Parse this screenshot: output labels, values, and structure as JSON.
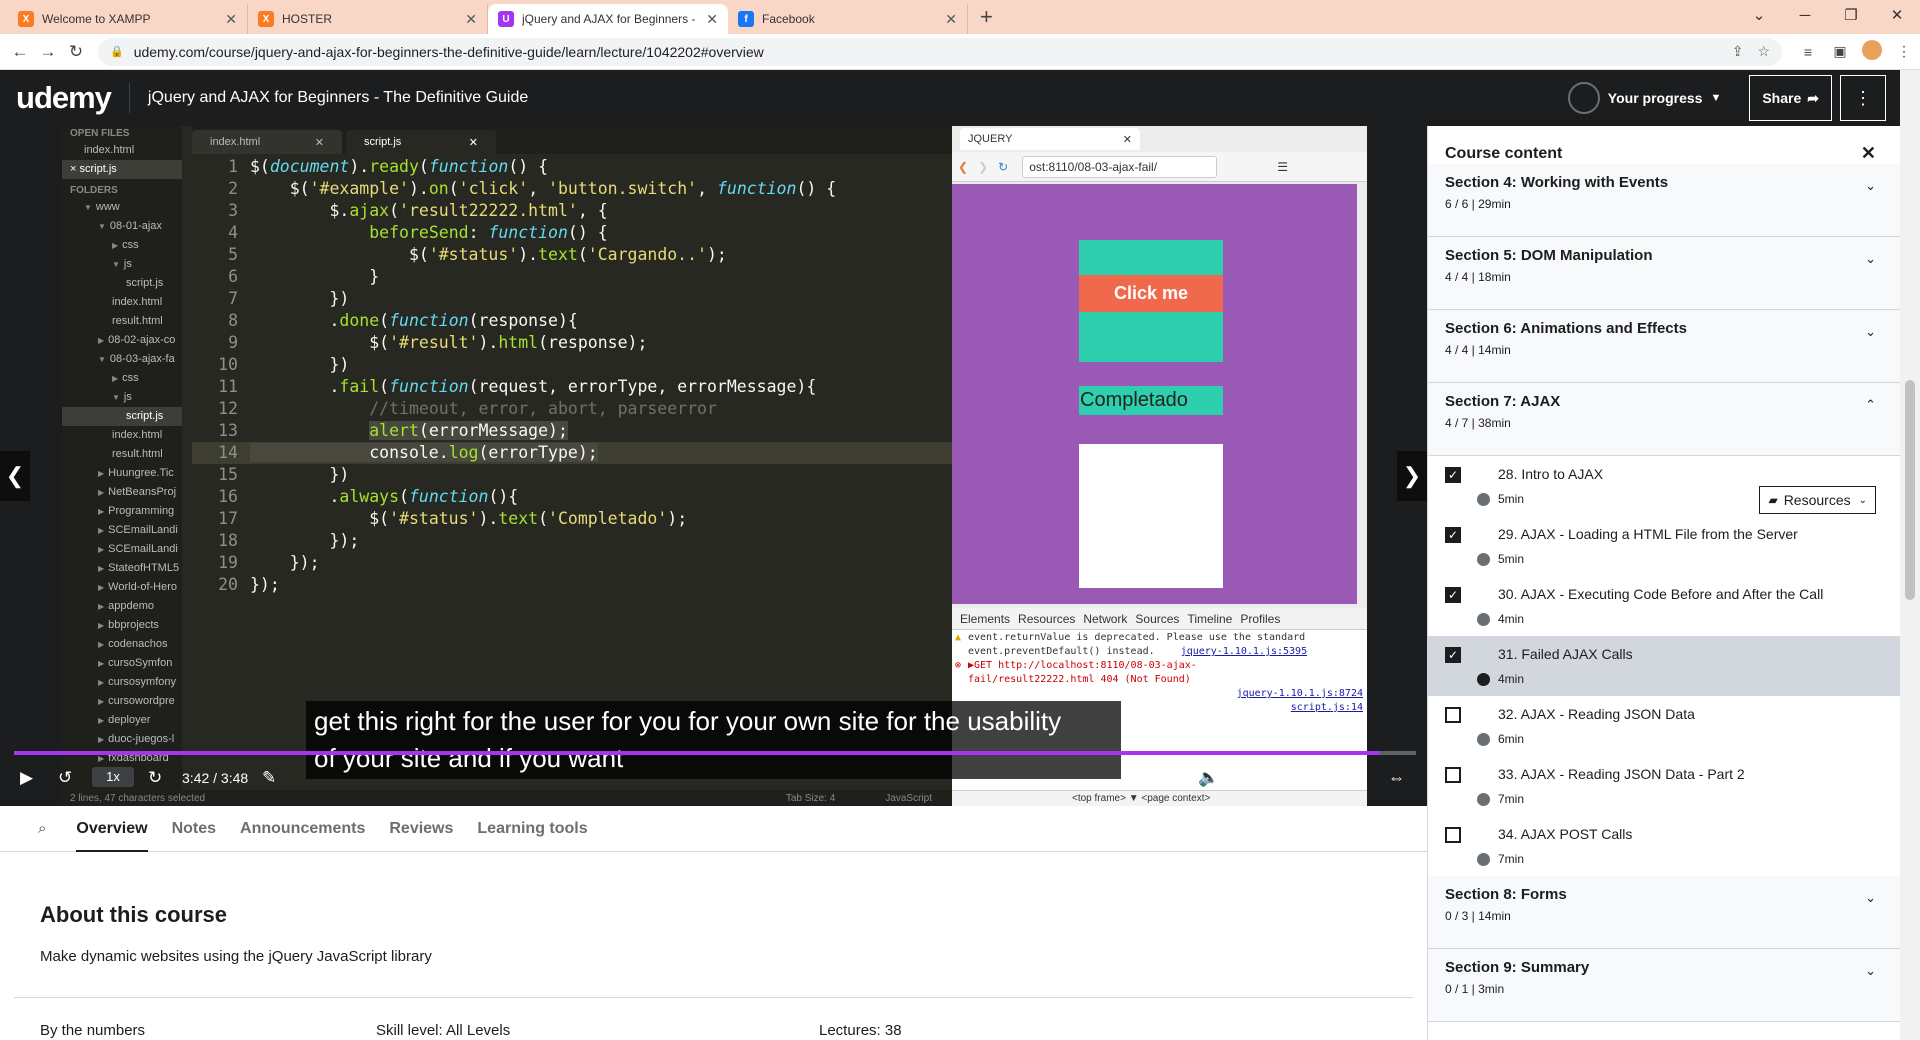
{
  "browser": {
    "tabs": [
      {
        "title": "Welcome to XAMPP",
        "fav": "X",
        "color": "#fb7a24"
      },
      {
        "title": "HOSTER",
        "fav": "X",
        "color": "#fb7a24"
      },
      {
        "title": "jQuery and AJAX for Beginners -",
        "fav": "U",
        "color": "#a435f0"
      },
      {
        "title": "Facebook",
        "fav": "f",
        "color": "#1877f2"
      }
    ],
    "url": "udemy.com/course/jquery-and-ajax-for-beginners-the-definitive-guide/learn/lecture/1042202#overview"
  },
  "header": {
    "logo_u": "u",
    "logo_rest": "demy",
    "course_title": "jQuery and AJAX for Beginners - The Definitive Guide",
    "progress_label": "Your progress",
    "share_label": "Share"
  },
  "editor": {
    "open_files_label": "OPEN FILES",
    "folders_label": "FOLDERS",
    "tree": [
      {
        "name": "index.html",
        "ind": 22
      },
      {
        "name": "× script.js",
        "ind": 8,
        "sel": true
      },
      {
        "name": "www",
        "ind": 22,
        "arrow": "▼"
      },
      {
        "name": "08-01-ajax",
        "ind": 36,
        "arrow": "▼"
      },
      {
        "name": "css",
        "ind": 50,
        "arrow": "▶"
      },
      {
        "name": "js",
        "ind": 50,
        "arrow": "▼"
      },
      {
        "name": "script.js",
        "ind": 64
      },
      {
        "name": "index.html",
        "ind": 50
      },
      {
        "name": "result.html",
        "ind": 50
      },
      {
        "name": "08-02-ajax-co",
        "ind": 36,
        "arrow": "▶"
      },
      {
        "name": "08-03-ajax-fa",
        "ind": 36,
        "arrow": "▼"
      },
      {
        "name": "css",
        "ind": 50,
        "arrow": "▶"
      },
      {
        "name": "js",
        "ind": 50,
        "arrow": "▼"
      },
      {
        "name": "script.js",
        "ind": 64,
        "sel": true
      },
      {
        "name": "index.html",
        "ind": 50
      },
      {
        "name": "result.html",
        "ind": 50
      },
      {
        "name": "Huungree.Tic",
        "ind": 36,
        "arrow": "▶"
      },
      {
        "name": "NetBeansProj",
        "ind": 36,
        "arrow": "▶"
      },
      {
        "name": "Programming",
        "ind": 36,
        "arrow": "▶"
      },
      {
        "name": "SCEmailLandi",
        "ind": 36,
        "arrow": "▶"
      },
      {
        "name": "SCEmailLandi",
        "ind": 36,
        "arrow": "▶"
      },
      {
        "name": "StateofHTML5",
        "ind": 36,
        "arrow": "▶"
      },
      {
        "name": "World-of-Hero",
        "ind": 36,
        "arrow": "▶"
      },
      {
        "name": "appdemo",
        "ind": 36,
        "arrow": "▶"
      },
      {
        "name": "bbprojects",
        "ind": 36,
        "arrow": "▶"
      },
      {
        "name": "codenachos",
        "ind": 36,
        "arrow": "▶"
      },
      {
        "name": "cursoSymfon",
        "ind": 36,
        "arrow": "▶"
      },
      {
        "name": "cursosymfony",
        "ind": 36,
        "arrow": "▶"
      },
      {
        "name": "cursowordpre",
        "ind": 36,
        "arrow": "▶"
      },
      {
        "name": "deployer",
        "ind": 36,
        "arrow": "▶"
      },
      {
        "name": "duoc-juegos-l",
        "ind": 36,
        "arrow": "▶"
      },
      {
        "name": "fxdashboard",
        "ind": 36,
        "arrow": "▶"
      }
    ],
    "tabs": [
      "index.html",
      "script.js"
    ],
    "lines": [
      "$(<k>document</k>).<f>ready</f>(<k>function</k>() {",
      "    $(<s>'#example'</s>).<f>on</f>(<s>'click'</s>, <s>'button.switch'</s>, <k>function</k>() {",
      "        $.<f>ajax</f>(<s>'result22222.html'</s>, {",
      "            <f>beforeSend</f>: <k>function</k>() {",
      "                $(<s>'#status'</s>).<f>text</f>(<s>'Cargando..'</s>);",
      "            }",
      "        })",
      "        .<f>done</f>(<k>function</k>(response){",
      "            $(<s>'#result'</s>).<f>html</f>(response);",
      "        })",
      "        .<f>fail</f>(<k>function</k>(request, errorType, errorMessage){",
      "            <c>//timeout, error, abort, parseerror</c>",
      "            <sel><f>alert</f>(errorMessage);</sel>",
      "<sel>            console.<f>log</f>(errorType);</sel>",
      "        })",
      "        .<f>always</f>(<k>function</k>(){",
      "            $(<s>'#status'</s>).<f>text</f>(<s>'Completado'</s>);",
      "        });",
      "    });",
      "});"
    ],
    "status_left": "2 lines, 47 characters selected",
    "tab_size": "Tab Size: 4",
    "syntax": "JavaScript"
  },
  "preview": {
    "tab": "JQUERY",
    "url": "ost:8110/08-03-ajax-fail/",
    "click_label": "Click me",
    "status_text": "Completado",
    "devtools_tabs": [
      "Elements",
      "Resources",
      "Network",
      "Sources",
      "Timeline",
      "Profiles"
    ],
    "warn1": "event.returnValue is deprecated. Please use the standard",
    "warn2": "event.preventDefault() instead.",
    "warn_src": "jquery-1.10.1.js:5395",
    "err1": "▶GET http://localhost:8110/08-03-ajax-",
    "err2": "fail/result22222.html 404 (Not Found)",
    "err_src1": "jquery-1.10.1.js:8724",
    "err_src2": "script.js:14",
    "bottom": "<top frame> ▼   <page context>"
  },
  "video": {
    "caption_1": "get this right for the user for you for your own site for the usability",
    "caption_2": "of your site and if you want",
    "speed": "1x",
    "time": "3:42 / 3:48",
    "progress_fraction": 0.974
  },
  "lower": {
    "tabs": [
      "Overview",
      "Notes",
      "Announcements",
      "Reviews",
      "Learning tools"
    ],
    "about_title": "About this course",
    "about_desc": "Make dynamic websites using the jQuery JavaScript library",
    "by_numbers": "By the numbers",
    "skill": "Skill level: All Levels",
    "lectures": "Lectures: 38"
  },
  "sidebar": {
    "title": "Course content",
    "sections_top": [
      {
        "title": "Section 4: Working with Events",
        "meta": "6 / 6 | 29min"
      },
      {
        "title": "Section 5: DOM Manipulation",
        "meta": "4 / 4 | 18min"
      },
      {
        "title": "Section 6: Animations and Effects",
        "meta": "4 / 4 | 14min"
      },
      {
        "title": "Section 7: AJAX",
        "meta": "4 / 7 | 38min",
        "open": true
      }
    ],
    "lectures": [
      {
        "title": "28. Intro to AJAX",
        "dur": "5min",
        "done": true,
        "resources": true
      },
      {
        "title": "29. AJAX - Loading a HTML File from the Server",
        "dur": "5min",
        "done": true
      },
      {
        "title": "30. AJAX - Executing Code Before and After the Call",
        "dur": "4min",
        "done": true
      },
      {
        "title": "31. Failed AJAX Calls",
        "dur": "4min",
        "done": true,
        "current": true
      },
      {
        "title": "32. AJAX - Reading JSON Data",
        "dur": "6min",
        "done": false
      },
      {
        "title": "33. AJAX - Reading JSON Data - Part 2",
        "dur": "7min",
        "done": false
      },
      {
        "title": "34. AJAX POST Calls",
        "dur": "7min",
        "done": false
      }
    ],
    "resources_label": "Resources",
    "sections_bottom": [
      {
        "title": "Section 8: Forms",
        "meta": "0 / 3 | 14min"
      },
      {
        "title": "Section 9: Summary",
        "meta": "0 / 1 | 3min"
      }
    ]
  }
}
